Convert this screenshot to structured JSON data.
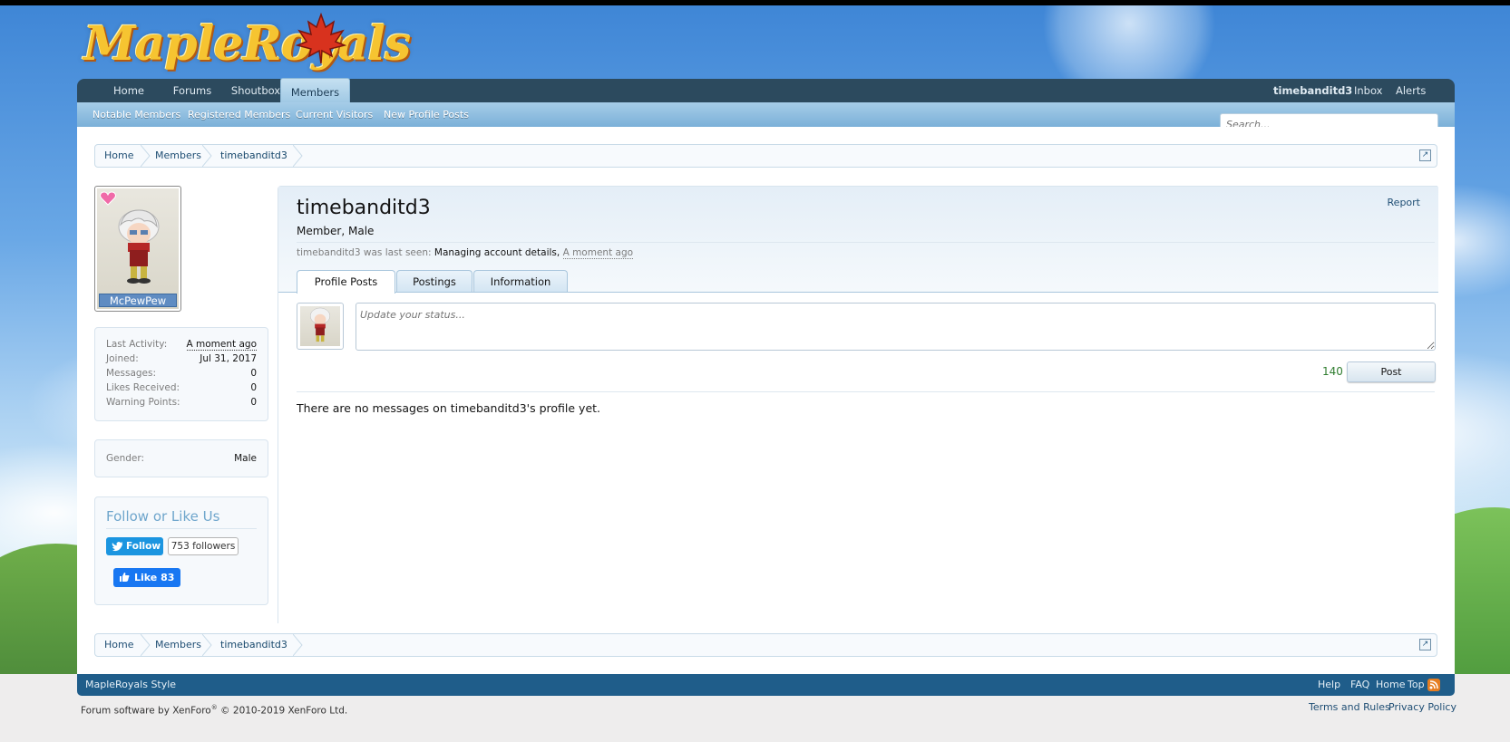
{
  "header": {
    "logo_text": "MapleRoyals"
  },
  "nav": {
    "tabs": [
      {
        "label": "Home"
      },
      {
        "label": "Forums"
      },
      {
        "label": "Shoutbox"
      },
      {
        "label": "Members",
        "active": true
      }
    ],
    "right_links": [
      {
        "label": "timebanditd3"
      },
      {
        "label": "Inbox"
      },
      {
        "label": "Alerts"
      }
    ],
    "subnav": [
      {
        "label": "Notable Members"
      },
      {
        "label": "Registered Members"
      },
      {
        "label": "Current Visitors"
      },
      {
        "label": "New Profile Posts"
      }
    ],
    "search_placeholder": "Search..."
  },
  "breadcrumb": {
    "items": [
      "Home",
      "Members",
      "timebanditd3"
    ]
  },
  "sidebar": {
    "avatar_name": "McPewPew",
    "stats": [
      {
        "key": "Last Activity:",
        "value": "A moment ago"
      },
      {
        "key": "Joined:",
        "value": "Jul 31, 2017"
      },
      {
        "key": "Messages:",
        "value": "0"
      },
      {
        "key": "Likes Received:",
        "value": "0"
      },
      {
        "key": "Warning Points:",
        "value": "0"
      }
    ],
    "gender_key": "Gender:",
    "gender_value": "Male",
    "follow_title": "Follow or Like Us",
    "twitter_label": "Follow",
    "twitter_count": "753 followers",
    "facebook_label": "Like 83"
  },
  "profile": {
    "username": "timebanditd3",
    "user_title": "Member, Male",
    "report_label": "Report",
    "last_seen_prefix": "timebanditd3 was last seen:",
    "last_seen_activity": "Managing account details,",
    "last_seen_time": "A moment ago",
    "tabs": [
      {
        "label": "Profile Posts",
        "active": true
      },
      {
        "label": "Postings"
      },
      {
        "label": "Information"
      }
    ],
    "status_placeholder": "Update your status...",
    "char_counter": "140",
    "post_button": "Post",
    "no_messages": "There are no messages on timebanditd3's profile yet."
  },
  "footer": {
    "style_label": "MapleRoyals Style",
    "links": [
      "Help",
      "FAQ",
      "Home",
      "Top"
    ],
    "legal_prefix": "Forum software by XenForo",
    "legal_suffix": " © 2010-2019 XenForo Ltd.",
    "legal_mark": "®",
    "terms": "Terms and Rules",
    "privacy": "Privacy Policy"
  },
  "colors": {
    "nav_bg": "#2c4a5e",
    "subnav_bg": "#7bb0d8",
    "footer_bg": "#1f5d8a",
    "link": "#1f4e74",
    "counter_green": "#2f7d2f"
  }
}
